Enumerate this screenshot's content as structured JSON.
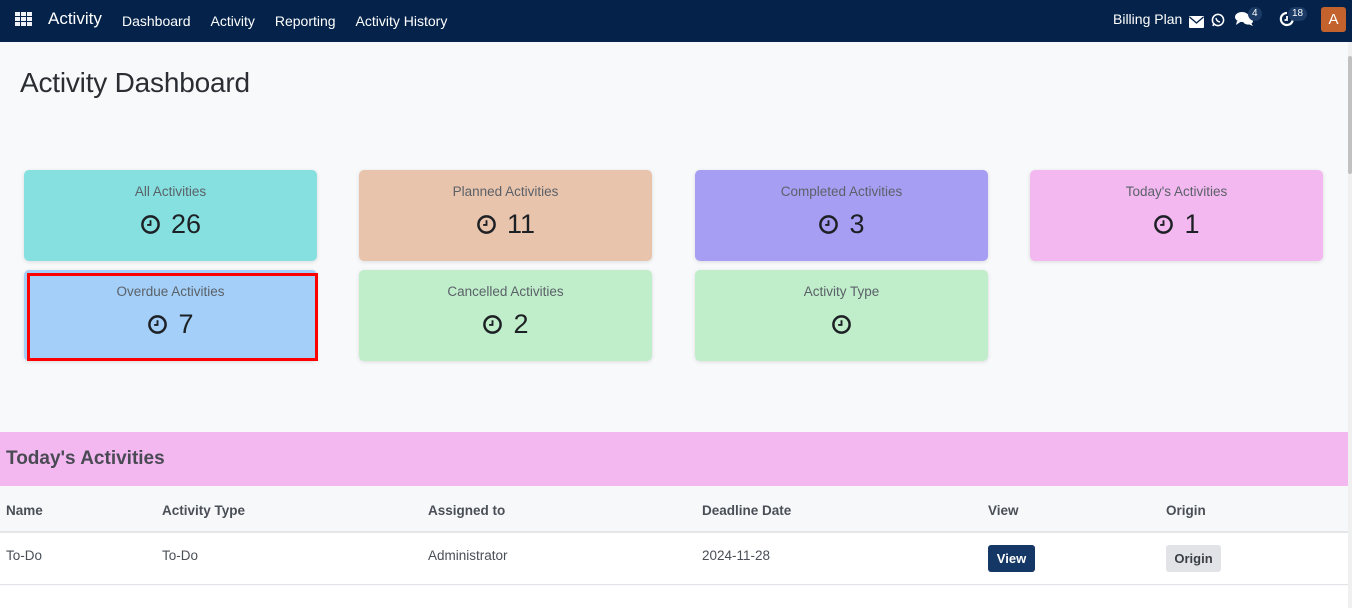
{
  "navbar": {
    "brand": "Activity",
    "menu": [
      {
        "label": "Dashboard"
      },
      {
        "label": "Activity"
      },
      {
        "label": "Reporting"
      },
      {
        "label": "Activity History"
      }
    ],
    "billing_plan": "Billing Plan",
    "messages_count": "4",
    "activities_count": "18",
    "avatar_initial": "A",
    "colors": {
      "background": "#05234a",
      "avatar": "#c4622d"
    }
  },
  "page": {
    "title": "Activity Dashboard"
  },
  "cards": [
    {
      "label": "All Activities",
      "value": "26",
      "color": "#86e0e0"
    },
    {
      "label": "Planned Activities",
      "value": "11",
      "color": "#e9c4ad"
    },
    {
      "label": "Completed Activities",
      "value": "3",
      "color": "#a69ef3"
    },
    {
      "label": "Today's Activities",
      "value": "1",
      "color": "#f3b8f0"
    },
    {
      "label": "Overdue Activities",
      "value": "7",
      "color": "#a3cff9",
      "highlighted": true
    },
    {
      "label": "Cancelled Activities",
      "value": "2",
      "color": "#c0eecb"
    },
    {
      "label": "Activity Type",
      "value": "",
      "color": "#c0eecb"
    }
  ],
  "todays_activities": {
    "title": "Today's Activities",
    "columns": [
      "Name",
      "Activity Type",
      "Assigned to",
      "Deadline Date",
      "View",
      "Origin"
    ],
    "rows": [
      {
        "name": "To-Do",
        "activity_type": "To-Do",
        "assigned_to": "Administrator",
        "deadline_date": "2024-11-28",
        "view_label": "View",
        "origin_label": "Origin"
      }
    ]
  }
}
